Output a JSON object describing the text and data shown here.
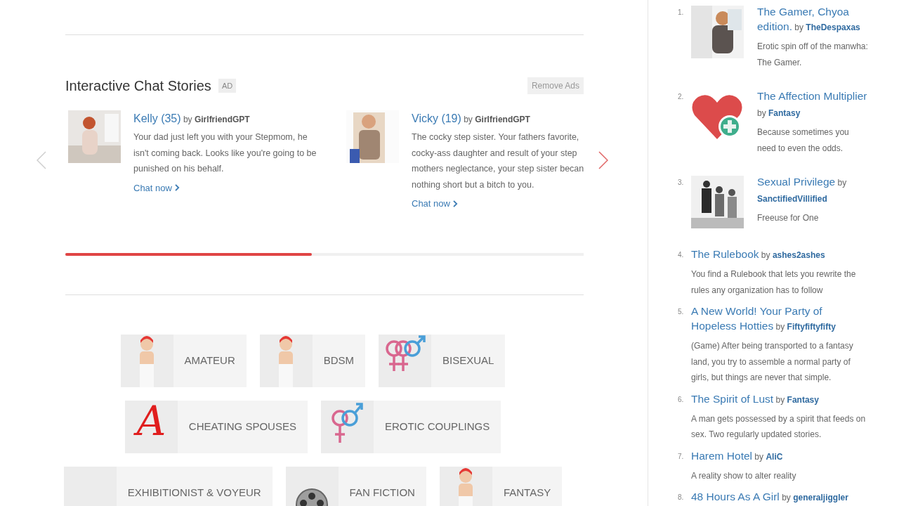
{
  "ad_section": {
    "title": "Interactive Chat Stories",
    "badge": "AD",
    "remove_button": "Remove Ads",
    "cards": [
      {
        "name": "Kelly (35)",
        "by": "by",
        "author": "GirlfriendGPT",
        "description": "Your dad just left you with your Stepmom, he isn't coming back. Looks like you're going to be punished on his behalf.",
        "link": "Chat now"
      },
      {
        "name": "Vicky (19)",
        "by": "by",
        "author": "GirlfriendGPT",
        "description": "The cocky step sister. Your fathers favorite, cocky-ass daughter and result of your step mothers neglectance, your step sister becan nothing short but a bitch to you.",
        "link": "Chat now"
      }
    ],
    "progress": {
      "level": 0.475
    }
  },
  "category_rows": [
    [
      {
        "label": "AMATEUR",
        "kind": "figure"
      },
      {
        "label": "BDSM",
        "kind": "figure"
      },
      {
        "label": "BISEXUAL",
        "kind": "venus-venus-mars"
      }
    ],
    [
      {
        "label": "CHEATING SPOUSES",
        "kind": "letter",
        "glyph": "A"
      },
      {
        "label": "EROTIC COUPLINGS",
        "kind": "venus-mars"
      }
    ],
    [
      {
        "label": "EXHIBITIONIST & VOYEUR",
        "kind": "blank"
      },
      {
        "label": "FAN FICTION",
        "kind": "reel"
      },
      {
        "label": "FANTASY",
        "kind": "figure"
      }
    ]
  ],
  "sidebar": {
    "items": [
      {
        "number": "1.",
        "title": "The Gamer, Chyoa edition.",
        "by": "by",
        "author": "TheDespaxas",
        "description": "Erotic spin off of the manwha: The Gamer.",
        "kind": "picture"
      },
      {
        "number": "2.",
        "title": "The Affection Multiplier",
        "by": "by",
        "author": "Fantasy",
        "description": "Because sometimes you need to even the odds.",
        "kind": "heart"
      },
      {
        "number": "3.",
        "title": "Sexual Privilege",
        "by": "by",
        "author": "SanctifiedVillified",
        "description": "Freeuse for One",
        "kind": "picture"
      },
      {
        "number": "4.",
        "title": "The Rulebook",
        "by": "by",
        "author": "ashes2ashes",
        "description": "You find a Rulebook that lets you rewrite the rules any organization has to follow",
        "kind": "text"
      },
      {
        "number": "5.",
        "title": "A New World! Your Party of Hopeless Hotties",
        "by": "by",
        "author": "Fiftyfiftyfifty",
        "description": "(Game) After being transported to a fantasy land, you try to assemble a normal party of girls, but things are never that simple.",
        "kind": "text"
      },
      {
        "number": "6.",
        "title": "The Spirit of Lust",
        "by": "by",
        "author": "Fantasy",
        "description": "A man gets possessed by a spirit that feeds on sex. Two regularly updated stories.",
        "kind": "text"
      },
      {
        "number": "7.",
        "title": "Harem Hotel",
        "by": "by",
        "author": "AliC",
        "description": "A reality show to alter reality",
        "kind": "text"
      },
      {
        "number": "8.",
        "title": "48 Hours As A Girl",
        "by": "by",
        "author": "generaljiggler",
        "kind": "text"
      }
    ]
  }
}
